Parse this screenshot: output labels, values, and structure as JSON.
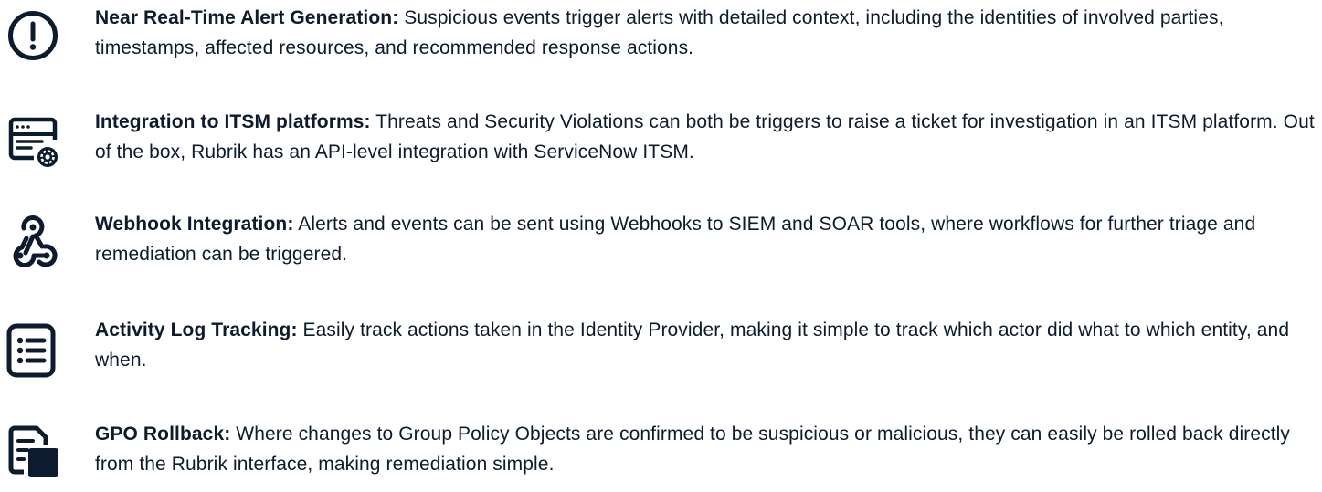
{
  "features": [
    {
      "icon": "alert-circle-icon",
      "title": "Near Real-Time Alert Generation:",
      "description": " Suspicious events trigger alerts with detailed context, including the identities of involved parties, timestamps, affected resources, and recommended response actions."
    },
    {
      "icon": "ticket-window-gear-icon",
      "title": "Integration to ITSM platforms:",
      "description": " Threats and Security Violations can both be triggers to raise a ticket for investigation in an ITSM platform. Out of the box, Rubrik has an API-level integration with ServiceNow ITSM."
    },
    {
      "icon": "webhook-icon",
      "title": "Webhook Integration:",
      "description": " Alerts and events can be sent using Webhooks to SIEM and SOAR tools, where workflows for further triage and remediation can be triggered."
    },
    {
      "icon": "checklist-icon",
      "title": "Activity Log Tracking:",
      "description": " Easily track actions taken in the Identity Provider, making it simple to track which actor did what to which entity, and when."
    },
    {
      "icon": "document-rollback-icon",
      "title": "GPO Rollback:",
      "description": " Where changes to Group Policy Objects are confirmed to be suspicious or malicious, they can easily be rolled back directly from the Rubrik interface, making remediation simple."
    }
  ],
  "colors": {
    "text": "#0d1b2e",
    "icon": "#0d1b2e"
  }
}
